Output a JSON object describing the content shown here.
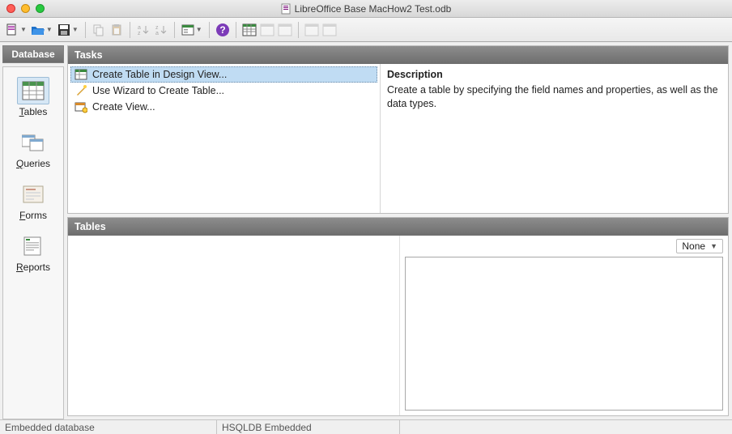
{
  "window": {
    "title": "LibreOffice Base MacHow2 Test.odb"
  },
  "sidebar": {
    "header": "Database",
    "items": [
      {
        "label": "Tables",
        "accesskey": "T",
        "active": true
      },
      {
        "label": "Queries",
        "accesskey": "Q",
        "active": false
      },
      {
        "label": "Forms",
        "accesskey": "F",
        "active": false
      },
      {
        "label": "Reports",
        "accesskey": "R",
        "active": false
      }
    ]
  },
  "tasks_panel": {
    "header": "Tasks",
    "items": [
      {
        "label": "Create Table in Design View...",
        "selected": true
      },
      {
        "label": "Use Wizard to Create Table...",
        "selected": false
      },
      {
        "label": "Create View...",
        "selected": false
      }
    ],
    "description": {
      "title": "Description",
      "text": "Create a table by specifying the field names and properties, as well as the data types."
    }
  },
  "tables_panel": {
    "header": "Tables",
    "preview_mode": "None"
  },
  "statusbar": {
    "label": "Embedded database",
    "engine": "HSQLDB Embedded"
  }
}
